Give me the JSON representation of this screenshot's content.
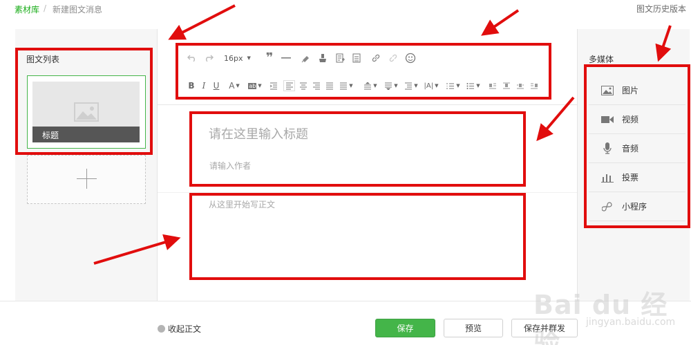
{
  "breadcrumb": {
    "library_link": "素材库",
    "separator": "/",
    "current": "新建图文消息"
  },
  "history_link": "图文历史版本",
  "left_panel": {
    "title": "图文列表",
    "card_caption": "标题",
    "card_image_icon": "image-placeholder-icon",
    "add_icon": "plus-icon"
  },
  "toolbar": {
    "font_size": "16px",
    "items": [
      "undo-icon",
      "redo-icon",
      "font-size-select",
      "blockquote-icon",
      "horizontal-rule-icon",
      "format-painter-icon",
      "clear-format-icon",
      "insert-template-icon",
      "paste-icon",
      "link-icon",
      "unlink-icon",
      "emoji-icon",
      "bold-icon",
      "italic-icon",
      "underline-icon",
      "font-color-icon",
      "background-color-icon",
      "indent-icon",
      "align-left-icon",
      "align-center-icon",
      "align-right-icon",
      "justify-icon",
      "line-spacing-icon",
      "paragraph-spacing-before-icon",
      "paragraph-spacing-after-icon",
      "letter-spacing-icon",
      "ordered-list-icon",
      "unordered-list-icon",
      "image-float-left-icon",
      "image-float-none-icon",
      "image-float-right-icon"
    ]
  },
  "editor": {
    "title_placeholder": "请在这里输入标题",
    "author_placeholder": "请输入作者",
    "body_placeholder": "从这里开始写正文"
  },
  "right_panel": {
    "title": "多媒体",
    "items": [
      {
        "label": "图片",
        "icon": "image-icon"
      },
      {
        "label": "视频",
        "icon": "video-icon"
      },
      {
        "label": "音频",
        "icon": "microphone-icon"
      },
      {
        "label": "投票",
        "icon": "bar-chart-icon"
      },
      {
        "label": "小程序",
        "icon": "mini-program-icon"
      }
    ]
  },
  "bottom_bar": {
    "collapse_label": "收起正文",
    "save_label": "保存",
    "preview_label": "预览",
    "send_label": "保存并群发"
  },
  "watermark": {
    "text": "Bai du 经验",
    "url": "jingyan.baidu.com"
  },
  "colors": {
    "accent_green": "#44b549",
    "annotation_red": "#e10d0d",
    "panel_gray": "#f6f6f6"
  }
}
